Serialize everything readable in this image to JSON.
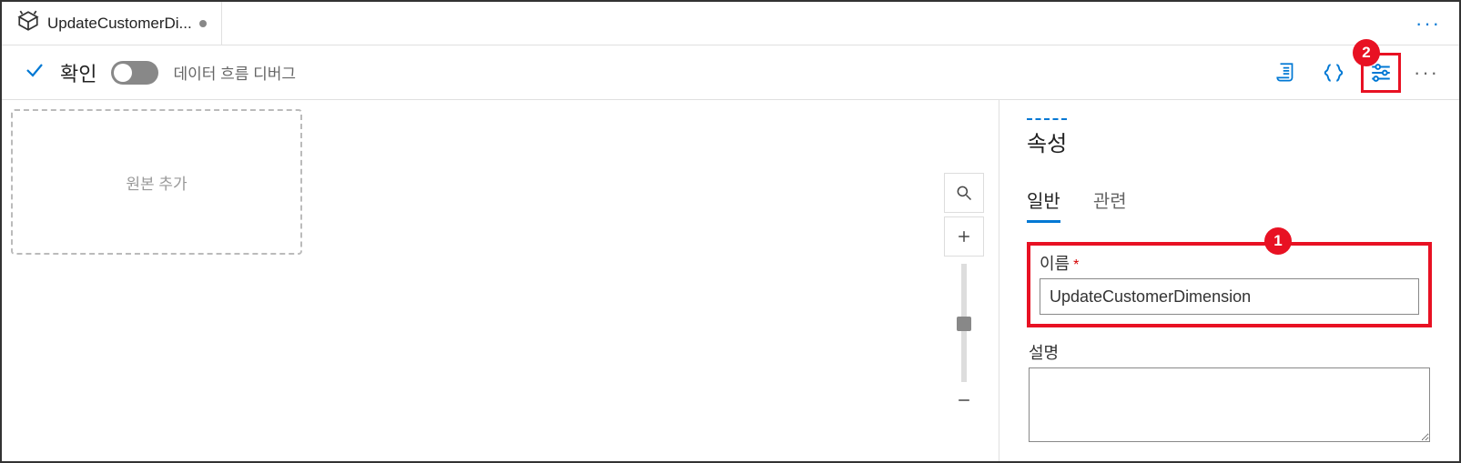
{
  "tab": {
    "title": "UpdateCustomerDi..."
  },
  "toolbar": {
    "validate_label": "확인",
    "debug_label": "데이터 흐름 디버그"
  },
  "canvas": {
    "add_source_label": "원본 추가"
  },
  "panel": {
    "title": "속성",
    "tabs": {
      "general": "일반",
      "related": "관련"
    },
    "name_label": "이름",
    "name_value": "UpdateCustomerDimension",
    "desc_label": "설명",
    "desc_value": ""
  },
  "callouts": {
    "one": "1",
    "two": "2"
  }
}
